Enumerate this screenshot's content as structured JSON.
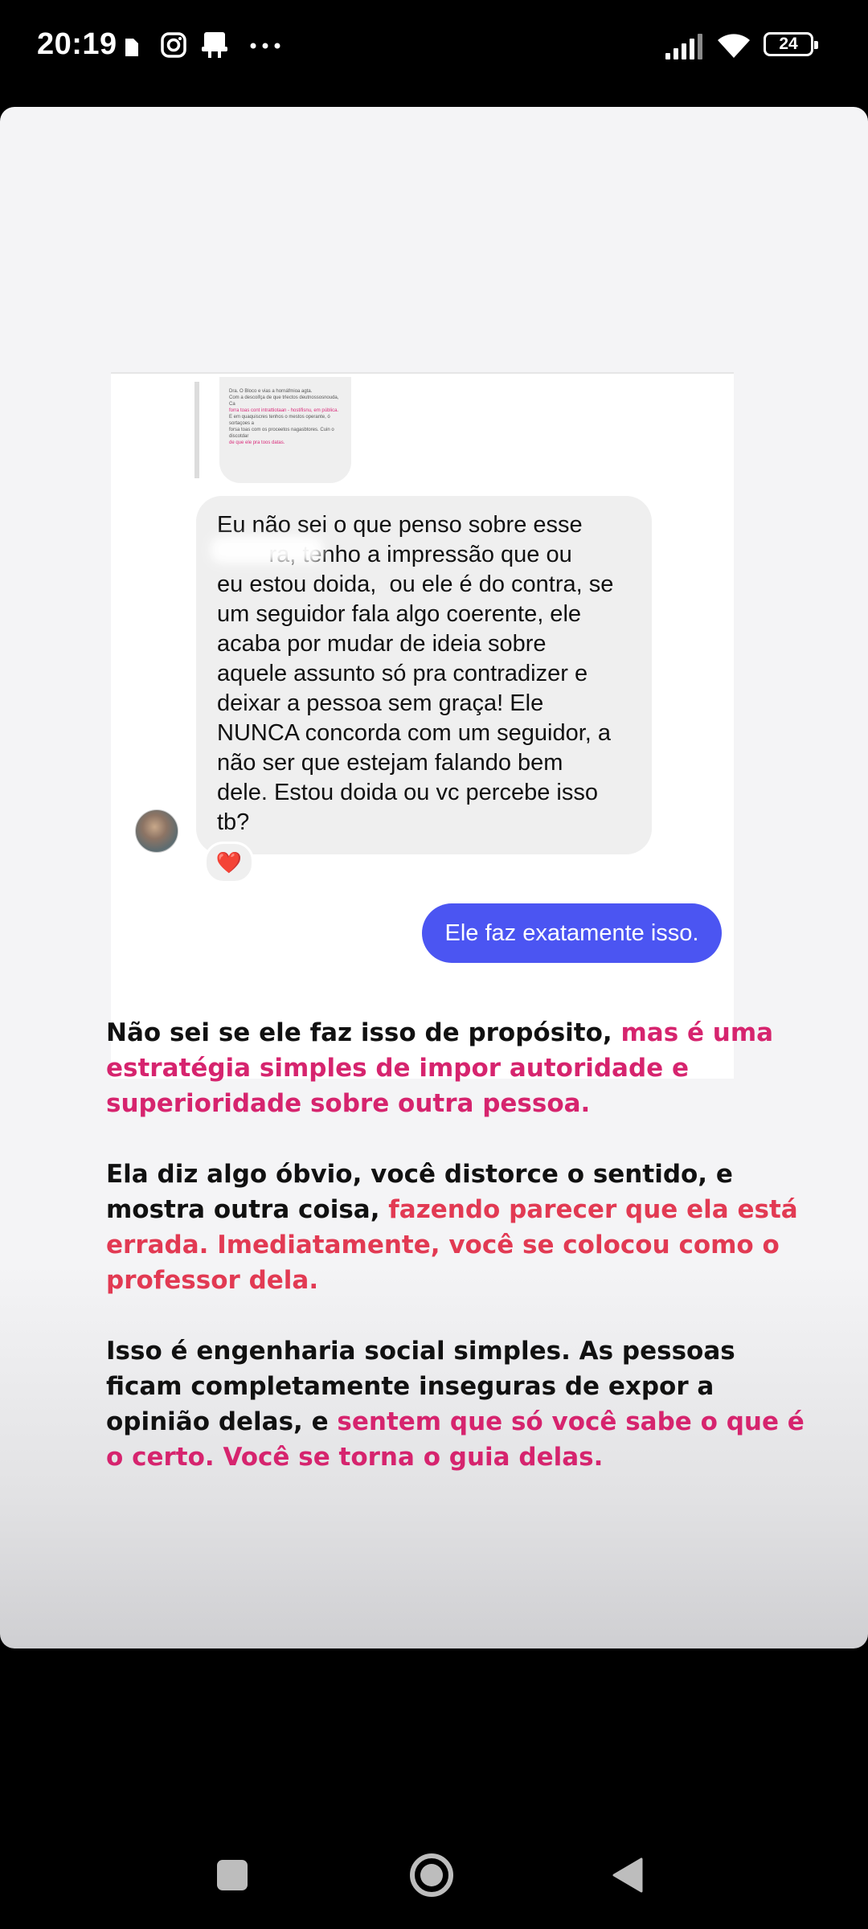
{
  "status_bar": {
    "time": "20:19",
    "battery": "24",
    "left_icons": [
      "sim-card-icon",
      "instagram-icon",
      "notification-icon",
      "more-dots-icon"
    ],
    "right_icons": [
      "signal-icon",
      "wifi-icon",
      "battery-icon"
    ]
  },
  "chat": {
    "quoted_lines": [
      "Dra. O Bloco e vias a hornáfmioa agta.",
      "Com a descoifça de que trlectos deutnossosnouda, Ca",
      "forra toas cont intrattiotaan - hostifisnu, em pública.",
      "E em quaquiscres tenhos o mestos operante, ó sortaçoes a",
      "forsa toas com os proceetos nagasbtores. Cuin o discotdar",
      "de que ele pra toos datas."
    ],
    "received_message": "Eu não sei o que penso sobre esse\n        ra, tenho a impressão que ou\neu estou doida,  ou ele é do contra, se\num seguidor fala algo coerente, ele\nacaba por mudar de ideia sobre\naquele assunto só pra contradizer e\ndeixar a pessoa sem graça! Ele\nNUNCA concorda com um seguidor, a\nnão ser que estejam falando bem\ndele. Estou doida ou vc percebe isso\ntb?",
    "reaction": "❤️",
    "sent_message": "Ele faz exatamente isso."
  },
  "story_text": {
    "p1_plain": "Não sei se ele faz isso de propósito, ",
    "p1_highlight": "mas é uma estratégia simples de impor autoridade e superioridade sobre outra pessoa.",
    "p2_plain": "Ela diz algo óbvio, você distorce o sentido, e mostra outra coisa, ",
    "p2_highlight": "fazendo parecer que ela está errada. Imediatamente, você se colocou como o professor dela.",
    "p3_plain": "Isso é engenharia social simples. As pessoas ficam completamente inseguras de expor a opinião delas, e ",
    "p3_highlight": "sentem que só você sabe o que é o certo. Você se torna o guia delas."
  },
  "colors": {
    "highlight_magenta": "#d6246e",
    "highlight_red": "#e23a53",
    "sent_bubble": "#4b55f2",
    "received_bubble": "#efefef"
  },
  "nav_bar": {
    "icons": [
      "recents-square-icon",
      "home-circle-icon",
      "back-triangle-icon"
    ]
  }
}
